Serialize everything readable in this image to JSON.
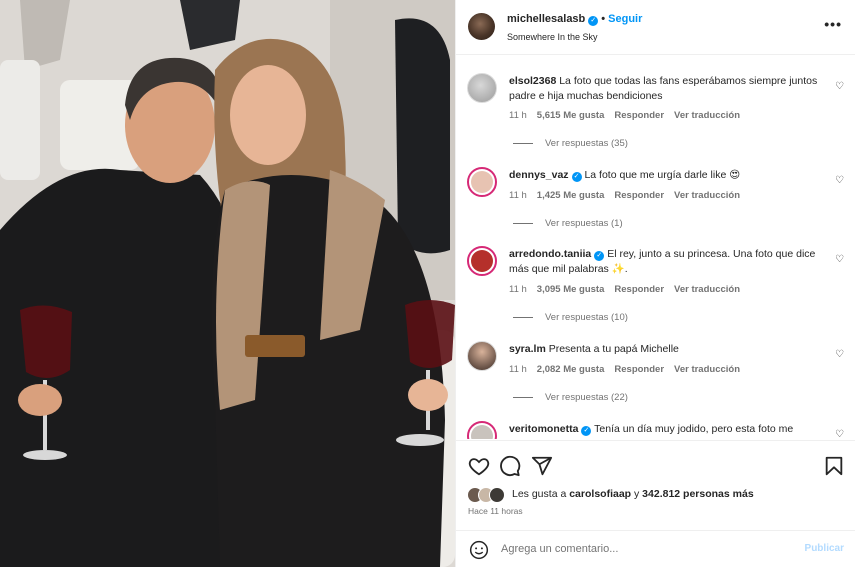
{
  "post": {
    "username": "michellesalasb",
    "follow_label": "Seguir",
    "location": "Somewhere In the Sky",
    "more_icon": "more-horizontal-icon"
  },
  "comments": [
    {
      "user": "elsol2368",
      "verified": false,
      "text": "La foto que todas las fans esperábamos siempre juntos padre e hija muchas bendiciones",
      "time": "11 h",
      "likes": "5,615 Me gusta",
      "reply": "Responder",
      "translate": "Ver traducción",
      "replies": "Ver respuestas (35)"
    },
    {
      "user": "dennys_vaz",
      "verified": true,
      "text": "La foto que me urgía darle like 😍",
      "time": "11 h",
      "likes": "1,425 Me gusta",
      "reply": "Responder",
      "translate": "Ver traducción",
      "replies": "Ver respuestas (1)"
    },
    {
      "user": "arredondo.taniia",
      "verified": true,
      "text": "El rey, junto a su princesa. Una foto que dice más que mil palabras ✨.",
      "time": "11 h",
      "likes": "3,095 Me gusta",
      "reply": "Responder",
      "translate": "Ver traducción",
      "replies": "Ver respuestas (10)"
    },
    {
      "user": "syra.lm",
      "verified": false,
      "text": "Presenta a tu papá Michelle",
      "time": "11 h",
      "likes": "2,082 Me gusta",
      "reply": "Responder",
      "translate": "Ver traducción",
      "replies": "Ver respuestas (22)"
    },
    {
      "user": "veritomonetta",
      "verified": true,
      "text": "Tenía un día muy jodido, pero esta foto me",
      "time": "",
      "likes": "",
      "reply": "",
      "translate": "",
      "replies": ""
    }
  ],
  "likes": {
    "prefix": "Les gusta a ",
    "user": "carolsofiaap",
    "middle": " y ",
    "count": "342.812 personas más"
  },
  "timestamp": "Hace 11 horas",
  "comment_box": {
    "placeholder": "Agrega un comentario...",
    "publish_label": "Publicar"
  },
  "colors": {
    "accent": "#0095f6",
    "text": "#262626",
    "muted": "#737373",
    "story_ring": "#d62976"
  }
}
